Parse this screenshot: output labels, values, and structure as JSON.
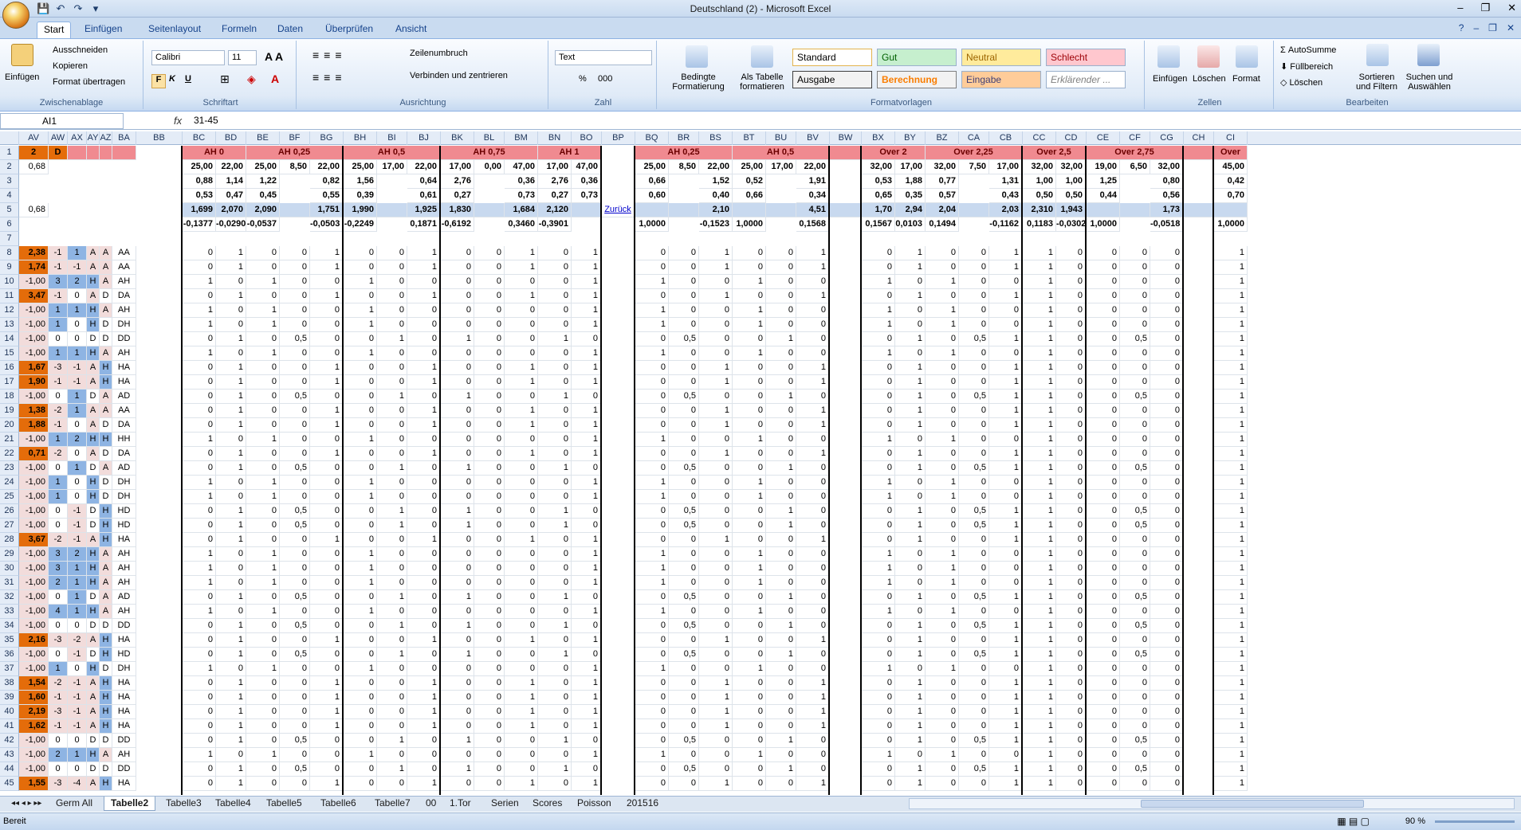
{
  "window": {
    "title": "Deutschland (2) - Microsoft Excel"
  },
  "ribbon_tabs": [
    "Start",
    "Einfügen",
    "Seitenlayout",
    "Formeln",
    "Daten",
    "Überprüfen",
    "Ansicht"
  ],
  "clipboard": {
    "paste": "Einfügen",
    "cut": "Ausschneiden",
    "copy": "Kopieren",
    "format_painter": "Format übertragen",
    "title": "Zwischenablage"
  },
  "font": {
    "name": "Calibri",
    "size": "11",
    "title": "Schriftart",
    "bold": "F",
    "italic": "K",
    "underline": "U"
  },
  "alignment": {
    "wrap": "Zeilenumbruch",
    "merge": "Verbinden und zentrieren",
    "title": "Ausrichtung"
  },
  "number": {
    "format": "Text",
    "title": "Zahl",
    "percent": "%",
    "thousands": "000"
  },
  "styles": {
    "cond": "Bedingte Formatierung",
    "table": "Als Tabelle formatieren",
    "title": "Formatvorlagen",
    "cells": [
      "Standard",
      "Gut",
      "Neutral",
      "Schlecht",
      "Ausgabe",
      "Berechnung",
      "Eingabe",
      "Erklärender ..."
    ]
  },
  "cells_group": {
    "insert": "Einfügen",
    "delete": "Löschen",
    "format": "Format",
    "title": "Zellen"
  },
  "edit": {
    "autosum": "AutoSumme",
    "fill": "Füllbereich",
    "clear": "Löschen",
    "sort": "Sortieren und Filtern",
    "find": "Suchen und Auswählen",
    "title": "Bearbeiten"
  },
  "formula_bar": {
    "name_box": "AI1",
    "fx": "fx",
    "formula": "31-45"
  },
  "columns": [
    "AV",
    "AW",
    "AX",
    "AY",
    "AZ",
    "BA",
    "BB",
    "BC",
    "BD",
    "BE",
    "BF",
    "BG",
    "BH",
    "BI",
    "BJ",
    "BK",
    "BL",
    "BM",
    "BN",
    "BO",
    "BP",
    "BQ",
    "BR",
    "BS",
    "BT",
    "BU",
    "BV",
    "BW",
    "BX",
    "BY",
    "BZ",
    "CA",
    "CB",
    "CC",
    "CD",
    "CE",
    "CF",
    "CG",
    "CH",
    "CI"
  ],
  "row1": {
    "AV": "2",
    "AW": "D",
    "ah0": "AH 0",
    "ah025": "AH 0,25",
    "ah05": "AH 0,5",
    "ah075": "AH 0,75",
    "ah1": "AH 1",
    "ah025b": "AH 0,25",
    "ah05b": "AH 0,5",
    "o2": "Over 2",
    "o225": "Over 2,25",
    "o25": "Over 2,5",
    "o275": "Over 2,75",
    "o3": "Over"
  },
  "row2": [
    "0,68",
    "25,00",
    "22,00",
    "25,00",
    "8,50",
    "22,00",
    "25,00",
    "17,00",
    "22,00",
    "17,00",
    "0,00",
    "47,00",
    "17,00",
    "47,00",
    "25,00",
    "8,50",
    "22,00",
    "25,00",
    "17,00",
    "22,00",
    "32,00",
    "17,00",
    "32,00",
    "7,50",
    "17,00",
    "32,00",
    "32,00",
    "19,00",
    "6,50",
    "32,00",
    "45,00"
  ],
  "row3": [
    "0,88",
    "1,14",
    "1,22",
    "0,82",
    "1,56",
    "0,64",
    "2,76",
    "0,36",
    "2,76",
    "0,36",
    "0,66",
    "1,52",
    "0,52",
    "1,91",
    "0,53",
    "1,88",
    "0,77",
    "1,31",
    "1,00",
    "1,00",
    "1,25",
    "0,80",
    "0,42"
  ],
  "row4": [
    "0,53",
    "0,47",
    "0,45",
    "0,55",
    "0,39",
    "0,61",
    "0,27",
    "0,73",
    "0,27",
    "0,73",
    "0,60",
    "0,40",
    "0,66",
    "0,34",
    "0,65",
    "0,35",
    "0,57",
    "0,43",
    "0,50",
    "0,50",
    "0,44",
    "0,56",
    "0,70"
  ],
  "row5": [
    "0,68",
    "1,699",
    "2,070",
    "2,090",
    "1,751",
    "1,990",
    "1,925",
    "1,830",
    "1,684",
    "2,120",
    "Zurück",
    "2,10",
    "4,51",
    "1,70",
    "2,94",
    "2,04",
    "2,03",
    "2,310",
    "1,943",
    "1,73"
  ],
  "row6": [
    "-0,1377",
    "-0,0290",
    "-0,0537",
    "-0,0503",
    "-0,2249",
    "0,1871",
    "-0,6192",
    "0,3460",
    "-0,3901",
    "1,0000",
    "-0,1523",
    "1,0000",
    "0,1568",
    "0,1567",
    "0,0103",
    "0,1494",
    "-0,1162",
    "0,1183",
    "-0,0302",
    "1,0000",
    "-0,0518",
    "1,0000"
  ],
  "data_rows": [
    [
      "8",
      "2,38",
      "-1",
      "1",
      "A",
      "A",
      "AA"
    ],
    [
      "9",
      "1,74",
      "-1",
      "-1",
      "A",
      "A",
      "AA"
    ],
    [
      "10",
      "-1,00",
      "3",
      "2",
      "H",
      "A",
      "AH"
    ],
    [
      "11",
      "3,47",
      "-1",
      "0",
      "A",
      "D",
      "DA"
    ],
    [
      "12",
      "-1,00",
      "1",
      "1",
      "H",
      "A",
      "AH"
    ],
    [
      "13",
      "-1,00",
      "1",
      "0",
      "H",
      "D",
      "DH"
    ],
    [
      "14",
      "-1,00",
      "0",
      "0",
      "D",
      "D",
      "DD"
    ],
    [
      "15",
      "-1,00",
      "1",
      "1",
      "H",
      "A",
      "AH"
    ],
    [
      "16",
      "1,67",
      "-3",
      "-1",
      "A",
      "H",
      "HA"
    ],
    [
      "17",
      "1,90",
      "-1",
      "-1",
      "A",
      "H",
      "HA"
    ],
    [
      "18",
      "-1,00",
      "0",
      "1",
      "D",
      "A",
      "AD"
    ],
    [
      "19",
      "1,38",
      "-2",
      "1",
      "A",
      "A",
      "AA"
    ],
    [
      "20",
      "1,88",
      "-1",
      "0",
      "A",
      "D",
      "DA"
    ],
    [
      "21",
      "-1,00",
      "1",
      "2",
      "H",
      "H",
      "HH"
    ],
    [
      "22",
      "0,71",
      "-2",
      "0",
      "A",
      "D",
      "DA"
    ],
    [
      "23",
      "-1,00",
      "0",
      "1",
      "D",
      "A",
      "AD"
    ],
    [
      "24",
      "-1,00",
      "1",
      "0",
      "H",
      "D",
      "DH"
    ],
    [
      "25",
      "-1,00",
      "1",
      "0",
      "H",
      "D",
      "DH"
    ],
    [
      "26",
      "-1,00",
      "0",
      "-1",
      "D",
      "H",
      "HD"
    ],
    [
      "27",
      "-1,00",
      "0",
      "-1",
      "D",
      "H",
      "HD"
    ],
    [
      "28",
      "3,67",
      "-2",
      "-1",
      "A",
      "H",
      "HA"
    ],
    [
      "29",
      "-1,00",
      "3",
      "2",
      "H",
      "A",
      "AH"
    ],
    [
      "30",
      "-1,00",
      "3",
      "1",
      "H",
      "A",
      "AH"
    ],
    [
      "31",
      "-1,00",
      "2",
      "1",
      "H",
      "A",
      "AH"
    ],
    [
      "32",
      "-1,00",
      "0",
      "1",
      "D",
      "A",
      "AD"
    ],
    [
      "33",
      "-1,00",
      "4",
      "1",
      "H",
      "A",
      "AH"
    ],
    [
      "34",
      "-1,00",
      "0",
      "0",
      "D",
      "D",
      "DD"
    ],
    [
      "35",
      "2,16",
      "-3",
      "-2",
      "A",
      "H",
      "HA"
    ],
    [
      "36",
      "-1,00",
      "0",
      "-1",
      "D",
      "H",
      "HD"
    ],
    [
      "37",
      "-1,00",
      "1",
      "0",
      "H",
      "D",
      "DH"
    ],
    [
      "38",
      "1,54",
      "-2",
      "-1",
      "A",
      "H",
      "HA"
    ],
    [
      "39",
      "1,60",
      "-1",
      "-1",
      "A",
      "H",
      "HA"
    ],
    [
      "40",
      "2,19",
      "-3",
      "-1",
      "A",
      "H",
      "HA"
    ],
    [
      "41",
      "1,62",
      "-1",
      "-1",
      "A",
      "H",
      "HA"
    ],
    [
      "42",
      "-1,00",
      "0",
      "0",
      "D",
      "D",
      "DD"
    ],
    [
      "43",
      "-1,00",
      "2",
      "1",
      "H",
      "A",
      "AH"
    ],
    [
      "44",
      "-1,00",
      "0",
      "0",
      "D",
      "D",
      "DD"
    ],
    [
      "45",
      "1,55",
      "-3",
      "-4",
      "A",
      "H",
      "HA"
    ]
  ],
  "sheet_tabs": [
    "Germ All",
    "Tabelle2",
    "Tabelle3",
    "Tabelle4",
    "Tabelle5",
    "Tabelle6",
    "Tabelle7",
    "00",
    "1.Tor",
    "Serien",
    "Scores",
    "Poisson",
    "201516"
  ],
  "status": {
    "text": "Bereit",
    "zoom": "90 %"
  }
}
